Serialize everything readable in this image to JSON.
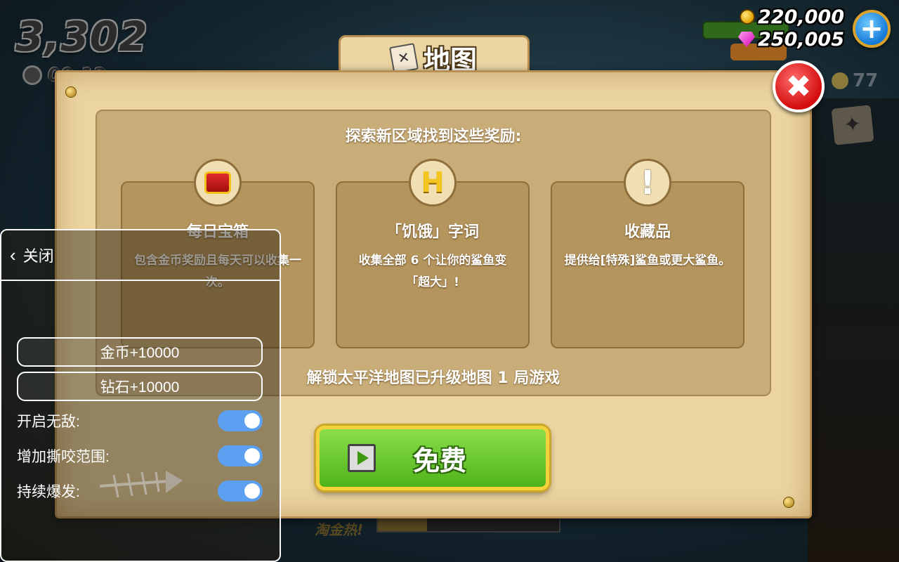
{
  "hud": {
    "score": "3,302",
    "timer": "00:12",
    "coins": "220,000",
    "gems": "250,005",
    "side_coin_count": "77",
    "bottom_label": "淘金热!"
  },
  "dialog": {
    "title": "地图",
    "heading": "探索新区域找到这些奖励:",
    "cards": [
      {
        "title": "每日宝箱",
        "desc": "包含金币奖励且每天可以收集一次。"
      },
      {
        "title": "「饥饿」字词",
        "desc": "收集全部 6 个让你的鲨鱼变「超大」!"
      },
      {
        "title": "收藏品",
        "desc": "提供给[特殊]鲨鱼或更大鲨鱼。"
      }
    ],
    "unlock_text": "解锁太平洋地图已升级地图 1 局游戏",
    "free_button": "免费"
  },
  "cheat_menu": {
    "close_label": "关闭",
    "buttons": [
      "金币+10000",
      "钻石+10000"
    ],
    "toggles": [
      {
        "label": "开启无敌:",
        "on": true
      },
      {
        "label": "增加撕咬范围:",
        "on": true
      },
      {
        "label": "持续爆发:",
        "on": true
      }
    ]
  },
  "colors": {
    "parchment": "#ecd5a2",
    "green_button": "#5fc027",
    "toggle_on": "#5ca0f2",
    "close_red": "#d30d0d"
  }
}
